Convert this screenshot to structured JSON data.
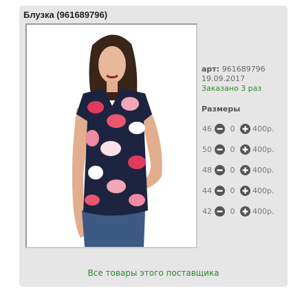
{
  "product": {
    "title": "Блузка (961689796)",
    "article_label": "арт:",
    "article": "961689796",
    "date": "19.09.2017",
    "ordered": "Заказано 3 раз"
  },
  "sizes_title": "Размеры",
  "sizes": [
    {
      "size": "46",
      "qty": "0",
      "price": "400р."
    },
    {
      "size": "50",
      "qty": "0",
      "price": "400р."
    },
    {
      "size": "48",
      "qty": "0",
      "price": "400р."
    },
    {
      "size": "44",
      "qty": "0",
      "price": "400р."
    },
    {
      "size": "42",
      "qty": "0",
      "price": "400р."
    }
  ],
  "supplier_link": "Все товары этого поставщика",
  "icons": {
    "decrease": "minus-circle-icon",
    "increase": "plus-circle-icon"
  },
  "colors": {
    "card": "#e6e6e6",
    "link": "#2a8a2a",
    "button": "#555555"
  }
}
